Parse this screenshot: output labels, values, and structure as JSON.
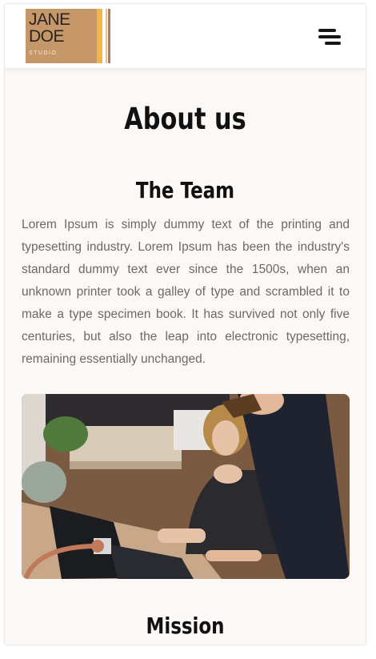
{
  "header": {
    "logo": {
      "name": "JANE DOE",
      "sub": "STUDIO"
    },
    "menu_icon": "hamburger-menu-icon"
  },
  "main": {
    "title": "About us",
    "team": {
      "heading": "The Team",
      "text": "Lorem Ipsum is simply dummy text of the printing and typesetting industry. Lorem Ipsum has been the industry's standard dummy text ever since the 1500s, when an unknown printer took a galley of type and scrambled it to make a type specimen book. It has survived not only five centuries, but also the leap into electronic typesetting, remaining essentially unchanged."
    },
    "mission": {
      "heading": "Mission"
    }
  },
  "colors": {
    "page_background": "#fcf8f5",
    "header_background": "#ffffff",
    "logo_tan": "#c69769",
    "logo_accent": "#f0b64a",
    "heading_text": "#111111",
    "body_text": "#6a6a6a"
  }
}
